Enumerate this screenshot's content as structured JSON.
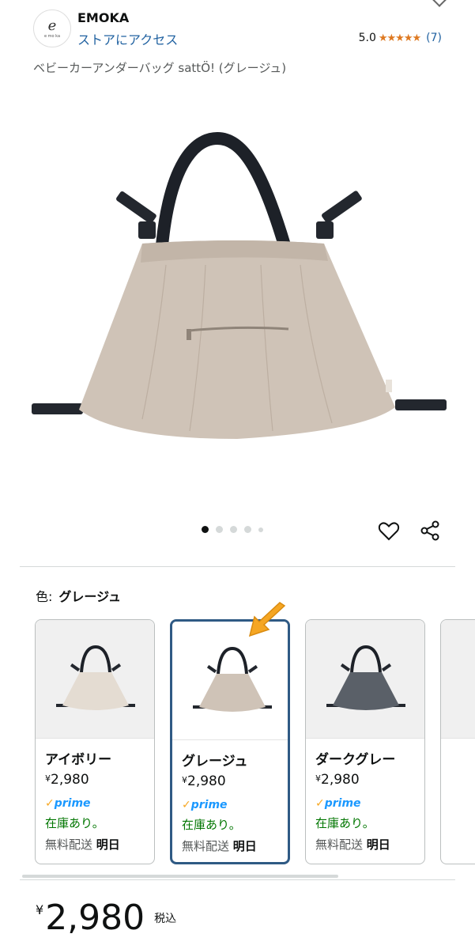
{
  "header": {
    "brand": "EMOKA",
    "store_link": "ストアにアクセス",
    "logo_letter": "e",
    "logo_caption": "e mo ka",
    "rating_value": "5.0",
    "rating_stars": "★★★★★",
    "rating_count": "(7)"
  },
  "product": {
    "title": "ベビーカーアンダーバッグ sattÖ! (グレージュ)",
    "image_count": 5,
    "active_image": 0
  },
  "color": {
    "label": "色:",
    "selected": "グレージュ"
  },
  "swatches": [
    {
      "name": "アイボリー",
      "yen": "¥",
      "price": "2,980",
      "prime": "prime",
      "stock": "在庫あり。",
      "ship_label": "無料配送",
      "ship_day": "明日",
      "color": "#e4dcd2"
    },
    {
      "name": "グレージュ",
      "yen": "¥",
      "price": "2,980",
      "prime": "prime",
      "stock": "在庫あり。",
      "ship_label": "無料配送",
      "ship_day": "明日",
      "color": "#cfc3b7"
    },
    {
      "name": "ダークグレー",
      "yen": "¥",
      "price": "2,980",
      "prime": "prime",
      "stock": "在庫あり。",
      "ship_label": "無料配送",
      "ship_day": "明日",
      "color": "#5a6068"
    }
  ],
  "price": {
    "yen": "¥",
    "amount": "2,980",
    "tax": "税込"
  },
  "colors": {
    "link": "#2162a1",
    "star": "#de7921",
    "selected_border": "#2f5a84",
    "stock": "#007600",
    "arrow": "#f5a623"
  }
}
